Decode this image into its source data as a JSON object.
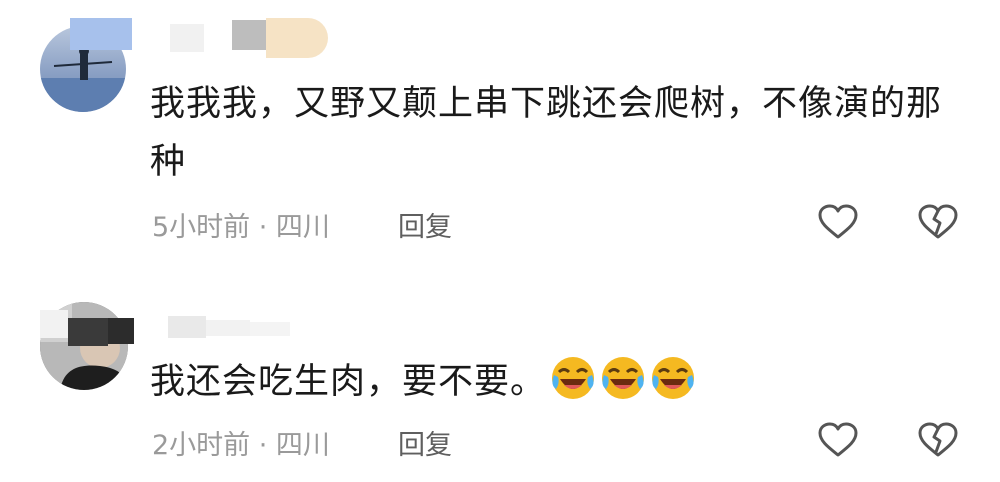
{
  "comments": [
    {
      "text_line1": "我我我，又野又颠上串下跳还会爬树，不像演的那",
      "text_line2": "种",
      "meta": "5小时前 · 四川",
      "reply": "回复"
    },
    {
      "text": "我还会吃生肉，要不要。",
      "meta": "2小时前 · 四川",
      "reply": "回复"
    }
  ],
  "icons": {
    "like": "heart-outline-icon",
    "dislike": "broken-heart-icon",
    "emoji": "laughing-crying-emoji"
  },
  "colors": {
    "text": "#1a1a1a",
    "meta": "#9a9a9a",
    "icon": "#555555",
    "emoji": "#f5b921"
  }
}
